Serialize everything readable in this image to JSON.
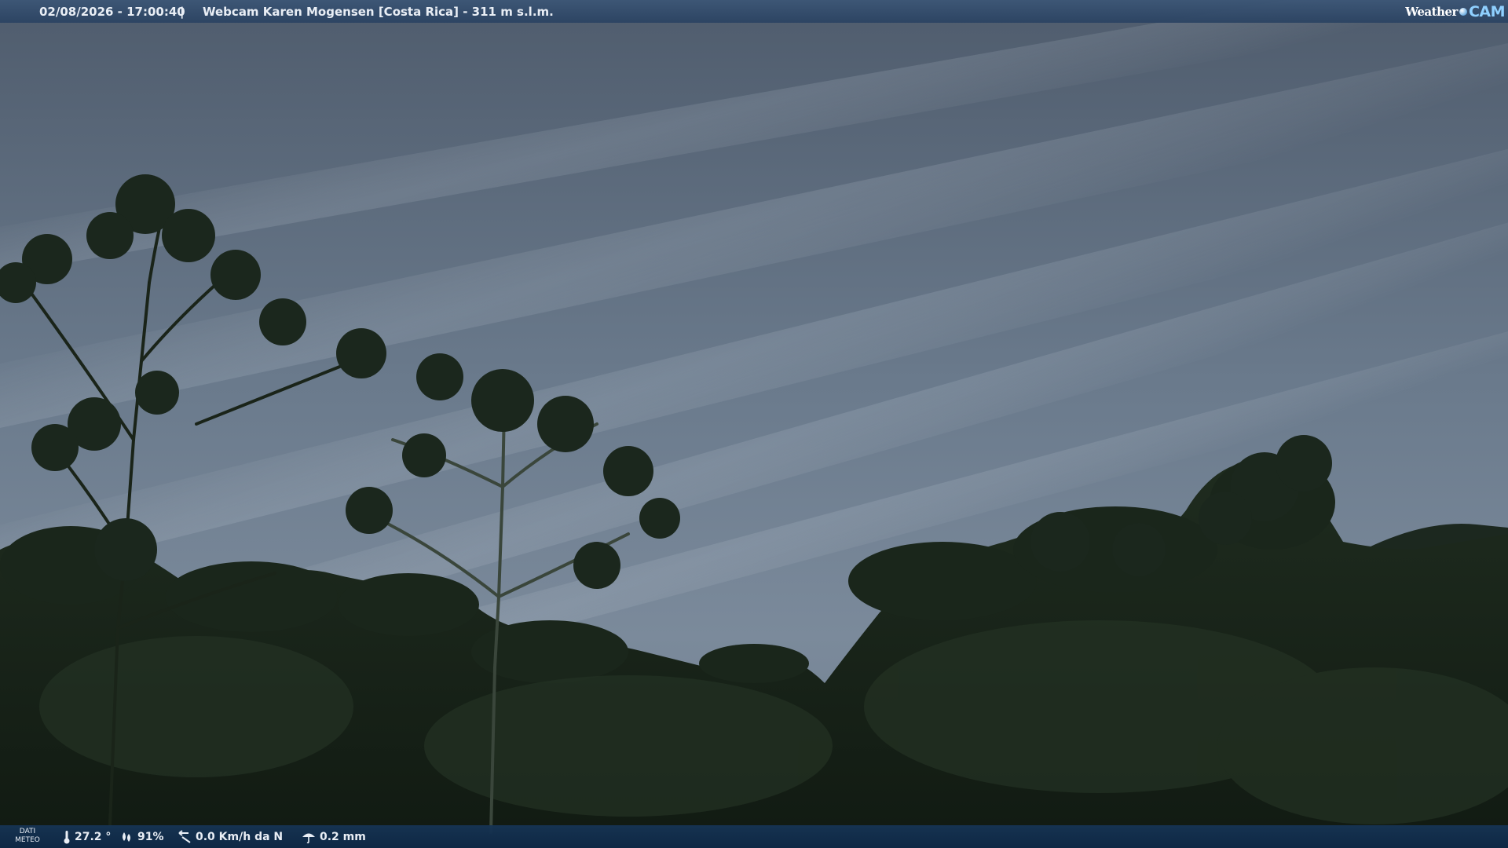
{
  "header": {
    "datetime": "02/08/2026 - 17:00:40",
    "separator": "|",
    "title": "Webcam Karen Mogensen [Costa Rica] - 311 m s.l.m."
  },
  "logo": {
    "weather_text": "Weather",
    "cam_text": "CAM"
  },
  "weather_bar": {
    "label_line1": "DATI",
    "label_line2": "METEO",
    "temperature": "27.2 °",
    "humidity": "91%",
    "wind": "0.0 Km/h da N",
    "rain": "0.2 mm"
  },
  "colors": {
    "sky_top": "#4f5c6d",
    "sky_mid": "#6c7c8e",
    "foliage_dark": "#152117",
    "foliage_mid": "#22301f",
    "bar_top": "#3c5676",
    "bar_bottom": "#163454"
  }
}
